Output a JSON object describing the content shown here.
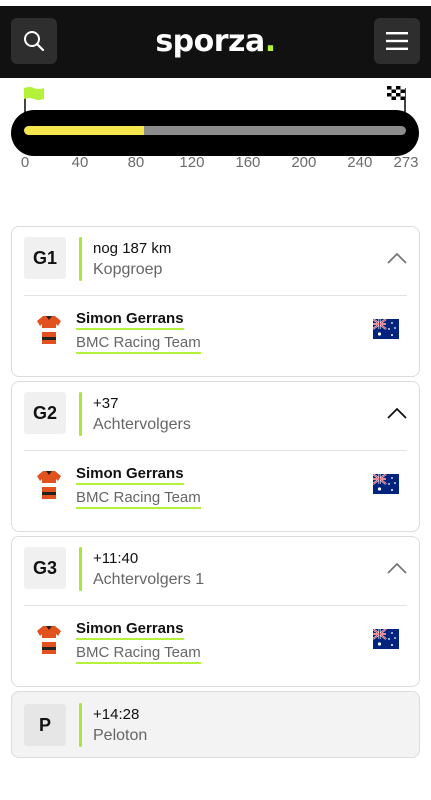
{
  "header": {
    "logo_text": "sporza",
    "logo_dot": ".",
    "search_icon": "search-icon",
    "menu_icon": "hamburger-menu-icon"
  },
  "race_progress": {
    "ticks": [
      "0",
      "40",
      "80",
      "120",
      "160",
      "200",
      "240",
      "273"
    ],
    "tick_values": [
      0,
      40,
      80,
      120,
      160,
      200,
      240,
      273
    ],
    "total_km": 273,
    "leader_km": 86,
    "start_flag_icon": "start-flag-icon",
    "finish_flag_icon": "finish-flag-icon",
    "colors": {
      "fill": "#f5e64e",
      "remaining": "#8c8c8c",
      "track": "#000000",
      "start_flag": "#b4f13b"
    }
  },
  "groups": [
    {
      "code": "G1",
      "time": "nog 187 km",
      "label": "Kopgroep",
      "rider": {
        "name": "Simon Gerrans",
        "team": "BMC Racing Team",
        "flag_icon": "australia-flag-icon",
        "jersey_icon": "jersey-icon"
      }
    },
    {
      "code": "G2",
      "time": "+37",
      "label": "Achtervolgers",
      "rider": {
        "name": "Simon Gerrans",
        "team": "BMC Racing Team",
        "flag_icon": "australia-flag-icon",
        "jersey_icon": "jersey-icon"
      }
    },
    {
      "code": "G3",
      "time": "+11:40",
      "label": "Achtervolgers 1",
      "rider": {
        "name": "Simon Gerrans",
        "team": "BMC Racing Team",
        "flag_icon": "australia-flag-icon",
        "jersey_icon": "jersey-icon"
      }
    },
    {
      "code": "P",
      "time": "+14:28",
      "label": "Peloton"
    }
  ],
  "colors": {
    "accent": "#b4f13b",
    "group_line": "#a8e63c",
    "header_bg": "#111111"
  }
}
